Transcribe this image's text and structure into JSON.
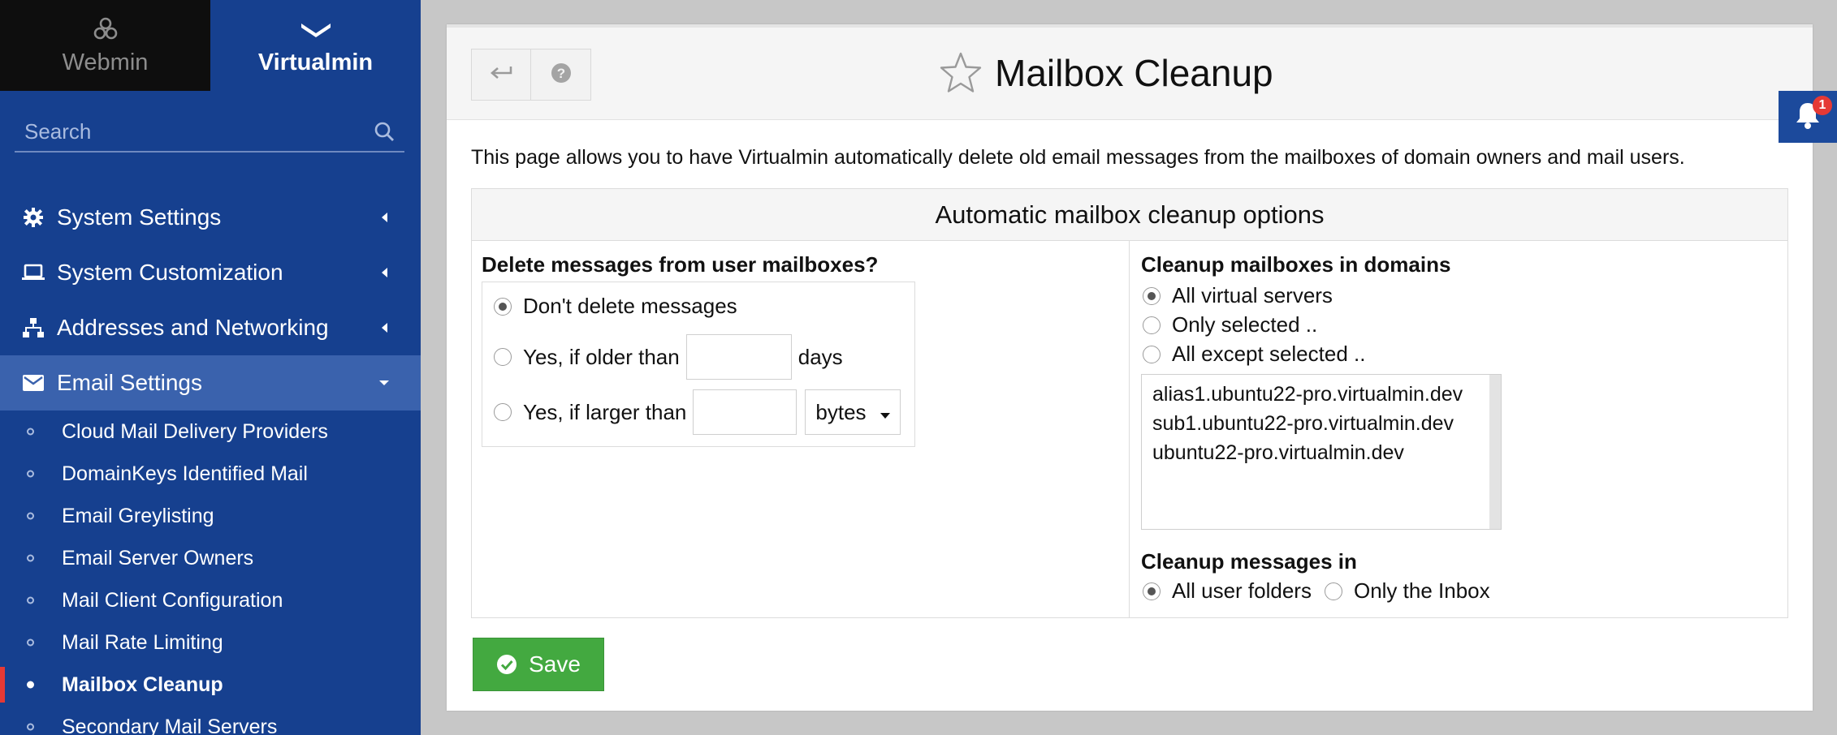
{
  "sidebar": {
    "tabs": {
      "webmin": "Webmin",
      "virtualmin": "Virtualmin"
    },
    "search_placeholder": "Search",
    "items": [
      {
        "label": "System Settings",
        "icon": "gear-icon"
      },
      {
        "label": "System Customization",
        "icon": "laptop-icon"
      },
      {
        "label": "Addresses and Networking",
        "icon": "network-icon"
      },
      {
        "label": "Email Settings",
        "icon": "envelope-icon"
      }
    ],
    "email_sub": [
      "Cloud Mail Delivery Providers",
      "DomainKeys Identified Mail",
      "Email Greylisting",
      "Email Server Owners",
      "Mail Client Configuration",
      "Mail Rate Limiting",
      "Mailbox Cleanup",
      "Secondary Mail Servers"
    ]
  },
  "header": {
    "title": "Mailbox Cleanup"
  },
  "intro": "This page allows you to have Virtualmin automatically delete old email messages from the mailboxes of domain owners and mail users.",
  "options": {
    "heading": "Automatic mailbox cleanup options",
    "delete": {
      "label": "Delete messages from user mailboxes?",
      "dont": "Don't delete messages",
      "older": "Yes, if older than",
      "days": "days",
      "larger": "Yes, if larger than",
      "unit": "bytes"
    },
    "domains": {
      "label": "Cleanup mailboxes in domains",
      "all": "All virtual servers",
      "only": "Only selected ..",
      "except": "All except selected ..",
      "list": [
        "alias1.ubuntu22-pro.virtualmin.dev",
        "sub1.ubuntu22-pro.virtualmin.dev",
        "ubuntu22-pro.virtualmin.dev"
      ]
    },
    "messages": {
      "label": "Cleanup messages in",
      "all": "All user folders",
      "inbox": "Only the Inbox"
    }
  },
  "save_label": "Save",
  "notifications": {
    "count": "1"
  },
  "colors": {
    "sidebar": "#16408f",
    "active_item": "#3a62ad",
    "save": "#43a940",
    "active_marker": "#e53935"
  }
}
